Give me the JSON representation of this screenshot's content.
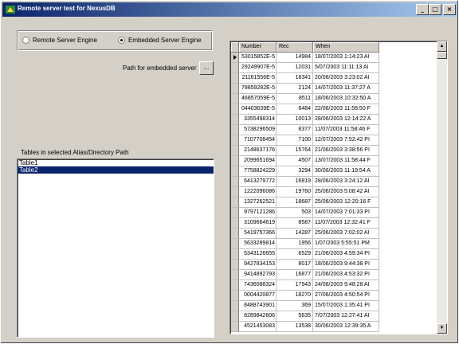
{
  "window": {
    "title": "Remote server test for NexusDB",
    "controls": {
      "minimize": "_",
      "maximize": "□",
      "close": "×"
    }
  },
  "engine": {
    "remote_label": "Remote Server Engine",
    "embedded_label": "Embedded Server Engine",
    "selected": "embedded"
  },
  "path": {
    "label": "Path for embedded server",
    "browse_label": "..."
  },
  "tables": {
    "label": "Tables in selected Alias/Directory Path",
    "items": [
      "Table1",
      "Table2"
    ],
    "selected_index": 1
  },
  "grid": {
    "columns": [
      "Number",
      "Rec",
      "When"
    ],
    "rows": [
      [
        "53015852E-5",
        "14984",
        "18/07/2003 1:14:23 AI"
      ],
      [
        "29249907E-5",
        "12031",
        "5/07/2003 11:11:13 AI"
      ],
      [
        "21161556E-5",
        "18341",
        "20/06/2003 3:23:02 AI"
      ],
      [
        "78859282E-5",
        "2124",
        "14/07/2003 11:37:27 A"
      ],
      [
        "46857059E-5",
        "8511",
        "18/06/2003 10:32:50 A"
      ],
      [
        "04403639E-5",
        "8484",
        "22/06/2003 11:58:50 F"
      ],
      [
        "3355498314",
        "10013",
        "28/06/2003 12:14:22 A"
      ],
      [
        "5738296509",
        "8377",
        "11/07/2003 11:58:46 F"
      ],
      [
        "7107708454",
        "7100",
        "12/07/2003 7:52:42 PI"
      ],
      [
        "2148637176",
        "15764",
        "21/06/2003 3:38:56 PI"
      ],
      [
        "2099651694",
        "4507",
        "13/07/2003 11:58:44 F"
      ],
      [
        "7758824229",
        "3294",
        "30/06/2003 11:19:54 A"
      ],
      [
        "6413279772",
        "16819",
        "28/06/2003 3:24:12 AI"
      ],
      [
        "1222096086",
        "19760",
        "25/06/2003 5:08:42 AI"
      ],
      [
        "1327262521",
        "18687",
        "25/06/2003 12:20:16 F"
      ],
      [
        "9797121286",
        "503",
        "14/07/2003 7:01:33 PI"
      ],
      [
        "3109664619",
        "8587",
        "11/07/2003 12:32:41 F"
      ],
      [
        "5419757366",
        "14287",
        "25/06/2003 7:02:02 AI"
      ],
      [
        "5633289814",
        "1956",
        "1/07/2003 5:55:51 PM"
      ],
      [
        "5343126655",
        "6529",
        "21/06/2003 4:59:34 PI"
      ],
      [
        "9427834153",
        "8017",
        "18/06/2003 9:44:38 PI"
      ],
      [
        "9414892793",
        "16877",
        "21/06/2003 4:53:32 PI"
      ],
      [
        "7436088324",
        "17943",
        "24/06/2003 9:48:28 AI"
      ],
      [
        "0004420877",
        "18270",
        "27/06/2003 4:50:54 PI"
      ],
      [
        "8488743901",
        "369",
        "15/07/2003 1:35:41 PI"
      ],
      [
        "8289842606",
        "5635",
        "7/07/2003 12:27:41 AI"
      ],
      [
        "4521453083",
        "13538",
        "30/06/2003 12:39:35 A"
      ]
    ]
  },
  "scrollbar": {
    "up": "▲",
    "down": "▼"
  }
}
